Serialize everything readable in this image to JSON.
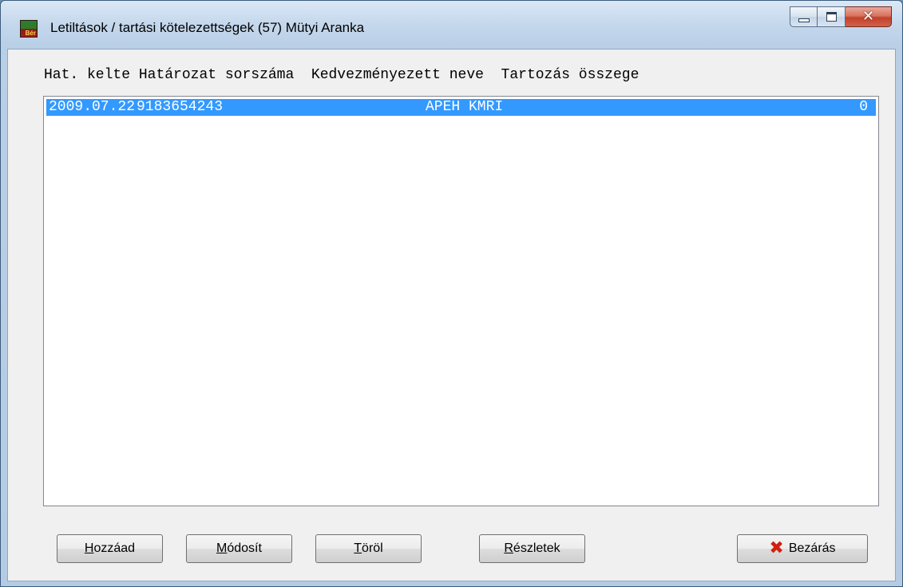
{
  "window": {
    "title": "Letiltások / tartási kötelezettségek (57) Mütyi Aranka",
    "icon_badge": "Bér",
    "controls": [
      "minimize",
      "maximize",
      "close"
    ]
  },
  "list": {
    "headers": {
      "date": "Hat. kelte",
      "number": "Határozat sorszáma",
      "beneficiary": "Kedvezményezett neve",
      "amount": "Tartozás összege"
    },
    "rows": [
      {
        "date": "2009.07.22",
        "number": "9183654243",
        "beneficiary": "APEH KMRI",
        "amount": "0",
        "selected": true
      }
    ]
  },
  "buttons": {
    "add": {
      "accel": "H",
      "rest": "ozzáad"
    },
    "modify": {
      "accel": "M",
      "rest": "ódosít"
    },
    "delete": {
      "accel": "T",
      "rest": "öröl"
    },
    "details": {
      "accel": "R",
      "rest": "észletek"
    },
    "close": {
      "label": "Bezárás",
      "icon": "x-icon"
    }
  },
  "colors": {
    "selection": "#3399ff",
    "close_icon": "#d1200f"
  }
}
